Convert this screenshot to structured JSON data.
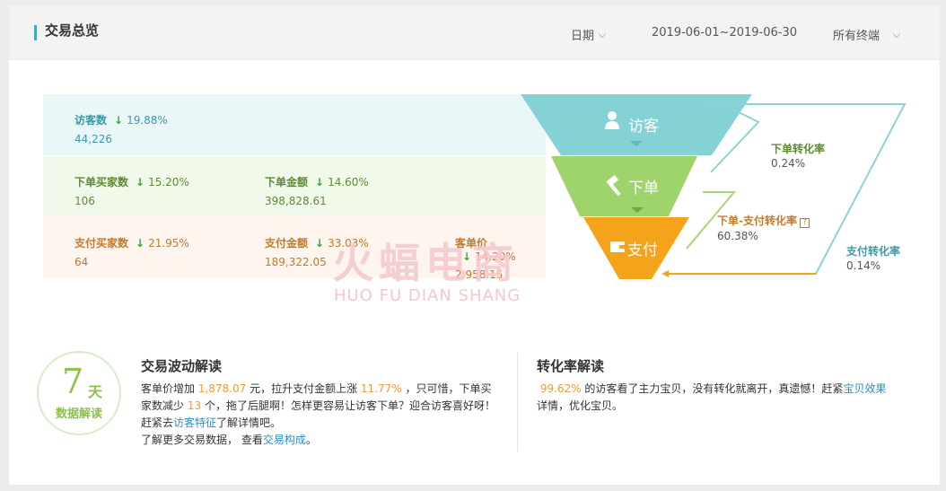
{
  "header": {
    "title": "交易总览",
    "date_label": "日期",
    "date_range": "2019-06-01~2019-06-30",
    "terminal": "所有终端"
  },
  "metrics": {
    "visitors": {
      "label": "访客数",
      "pct": "19.88%",
      "value": "44,226",
      "trend": "down"
    },
    "order_buyers": {
      "label": "下单买家数",
      "pct": "15.20%",
      "value": "106",
      "trend": "down"
    },
    "order_amount": {
      "label": "下单金额",
      "pct": "14.60%",
      "value": "398,828.61",
      "trend": "down"
    },
    "pay_buyers": {
      "label": "支付买家数",
      "pct": "21.95%",
      "value": "64",
      "trend": "down"
    },
    "pay_amount": {
      "label": "支付金额",
      "pct": "33.03%",
      "value": "189,322.05",
      "trend": "down"
    },
    "avg_price": {
      "label": "客单价",
      "pct": "14.20%",
      "value": "2,958.15",
      "trend": "down"
    }
  },
  "funnel": {
    "stage1": "访客",
    "stage2": "下单",
    "stage3": "支付",
    "colors": {
      "stage1": "#84d2d5",
      "stage2": "#9fd36b",
      "stage3": "#f6a31c"
    },
    "conv_order": {
      "label": "下单转化率",
      "value": "0.24%"
    },
    "conv_order_pay": {
      "label": "下单-支付转化率",
      "value": "60.38%"
    },
    "conv_pay": {
      "label": "支付转化率",
      "value": "0.14%"
    }
  },
  "watermark": {
    "cn": "火蝠电商",
    "en": "HUO FU DIAN SHANG"
  },
  "badge": {
    "number": "7",
    "unit": "天",
    "text": "数据解读"
  },
  "wave": {
    "title": "交易波动解读",
    "t1": "客单价增加",
    "v1": "1,878.07",
    "t2": "元，拉升支付金额上涨",
    "v2": "11.77%",
    "t3": "，只可惜，下单买",
    "t4": "家数减少",
    "v3": "13",
    "t5": "个，拖了后腿啊！怎样更容易让访客下单？迎合访客喜好呀！",
    "t6": "赶紧去",
    "link1": "访客特征",
    "t7": "了解详情吧。",
    "t8": "了解更多交易数据，  查看",
    "link2": "交易构成",
    "t9": "。"
  },
  "conv": {
    "title": "转化率解读",
    "v1": "99.62%",
    "t1": "的访客看了主力宝贝，没有转化就离开，真遗憾！赶紧",
    "link1": "宝贝效果",
    "t2": "详情，优化宝贝。"
  }
}
